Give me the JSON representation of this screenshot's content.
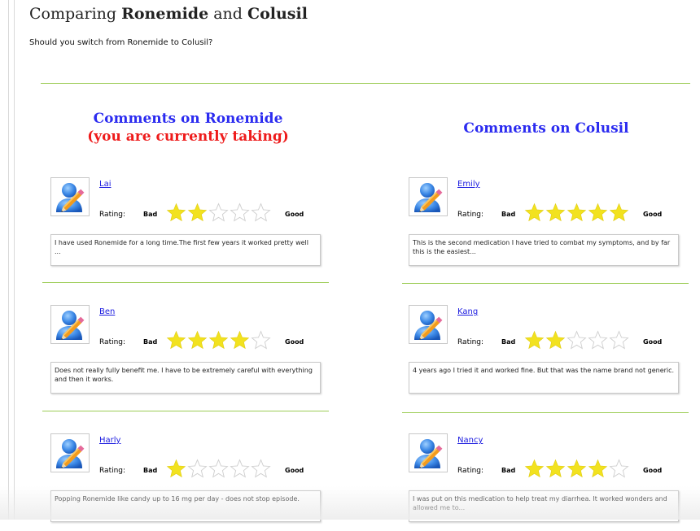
{
  "title": {
    "prefix": "Comparing ",
    "drug_a": "Ronemide",
    "middle": " and ",
    "drug_b": "Colusil"
  },
  "subtitle": "Should you switch from Ronemide to Colusil?",
  "left_column": {
    "heading": "Comments on Ronemide",
    "subheading": "(you are currently taking)",
    "reviews": [
      {
        "name": "Lai",
        "rating": 2,
        "rating_label": "Rating:",
        "bad": "Bad",
        "good": "Good",
        "comment": "I have used Ronemide for a long time.The first few years it worked pretty well ..."
      },
      {
        "name": "Ben",
        "rating": 4,
        "rating_label": "Rating:",
        "bad": "Bad",
        "good": "Good",
        "comment": "Does not really fully benefit me. I have to be extremely careful with everything and then it works."
      },
      {
        "name": "Harly",
        "rating": 1,
        "rating_label": "Rating:",
        "bad": "Bad",
        "good": "Good",
        "comment": "Popping Ronemide like candy up to 16 mg per day - does not stop episode."
      }
    ]
  },
  "right_column": {
    "heading": "Comments on Colusil",
    "reviews": [
      {
        "name": "Emily",
        "rating": 5,
        "rating_label": "Rating:",
        "bad": "Bad",
        "good": "Good",
        "comment": "This is the second medication I have tried to combat my symptoms, and by far this is the easiest..."
      },
      {
        "name": "Kang",
        "rating": 2,
        "rating_label": "Rating:",
        "bad": "Bad",
        "good": "Good",
        "comment": "4 years ago I tried it and worked fine. But that was the name brand not generic."
      },
      {
        "name": "Nancy",
        "rating": 4,
        "rating_label": "Rating:",
        "bad": "Bad",
        "good": "Good",
        "comment": "I was put on this medication to help treat my diarrhea. It worked wonders and allowed me to..."
      }
    ]
  },
  "max_stars": 5,
  "colors": {
    "link": "#1a1adf",
    "heading_blue": "#2b2bf0",
    "heading_red": "#ee1b1b",
    "divider_green": "#9ccc55",
    "star_filled": "#f2e21f",
    "star_empty_outline": "#cfcfcf"
  },
  "icons": {
    "avatar": "user-edit-icon",
    "star_filled": "star-filled-icon",
    "star_empty": "star-empty-icon"
  }
}
